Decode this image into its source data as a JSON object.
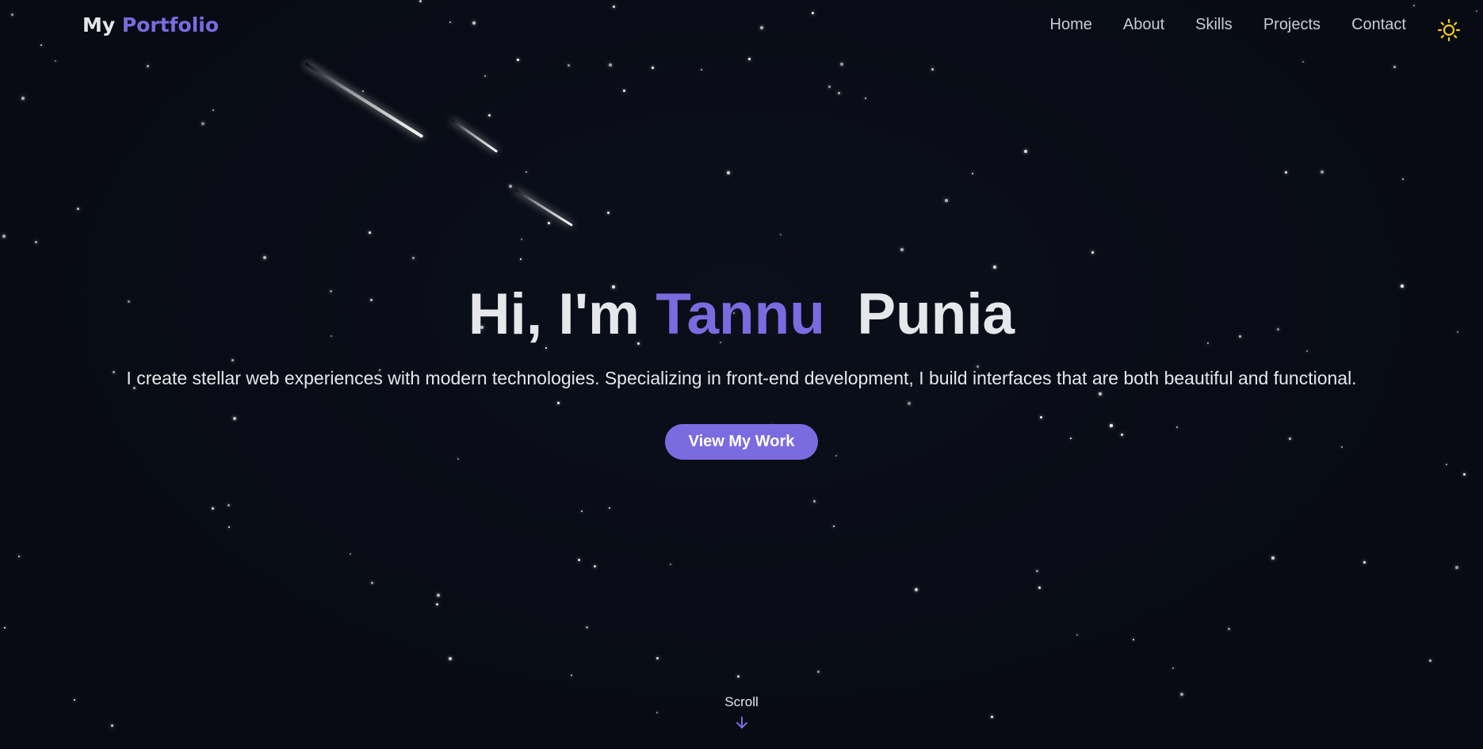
{
  "nav": {
    "logo_part1": "My",
    "logo_part2": "Portfolio",
    "links": [
      "Home",
      "About",
      "Skills",
      "Projects",
      "Contact"
    ],
    "theme_icon": "sun-icon"
  },
  "hero": {
    "greeting": "Hi, I'm",
    "first_name": "Tannu",
    "last_name": "Punia",
    "description": "I create stellar web experiences with modern technologies. Specializing in front-end development, I build interfaces that are both beautiful and functional.",
    "cta_label": "View My Work"
  },
  "scroll": {
    "label": "Scroll",
    "icon": "arrow-down-icon"
  },
  "colors": {
    "background": "#080b14",
    "accent": "#7c6be0",
    "text": "#e5e7eb",
    "sun": "#facc15"
  }
}
